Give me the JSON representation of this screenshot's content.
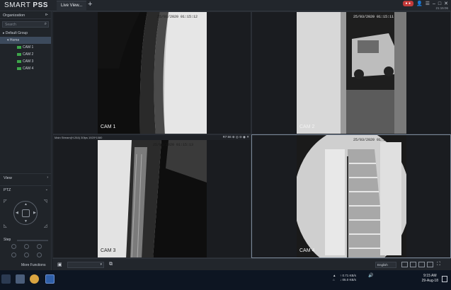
{
  "app": {
    "brand_a": "SMART ",
    "brand_b": "PSS",
    "tab_label": "Live View...",
    "tab_close": "×",
    "tab_add": "+",
    "alarm_badge": "● ●",
    "time_small": "21:15:06"
  },
  "sidebar": {
    "section_title": "Organization",
    "search_placeholder": "Search",
    "tree": [
      {
        "label": "Default Group",
        "level": 1,
        "selected": false
      },
      {
        "label": "Home",
        "level": 2,
        "selected": true
      },
      {
        "label": "CAM 1",
        "level": 3,
        "selected": false
      },
      {
        "label": "CAM 2",
        "level": 3,
        "selected": false
      },
      {
        "label": "CAM 3",
        "level": 3,
        "selected": false
      },
      {
        "label": "CAM 4",
        "level": 3,
        "selected": false
      }
    ],
    "view_label": "View",
    "ptz_label": "PTZ",
    "step_label": "Step",
    "more_label": "More Functions"
  },
  "grid": {
    "cells": [
      {
        "id": "cell-1",
        "cam": "CAM 1",
        "timestamp": "25/03/2020 01:15:12",
        "info": "",
        "active": false
      },
      {
        "id": "cell-2",
        "cam": "CAM 2",
        "timestamp": "25/03/2020 01:15:11",
        "info": "",
        "active": false
      },
      {
        "id": "cell-3",
        "cam": "CAM 3",
        "timestamp": "25/03/2020 01:15:13",
        "info": "Main Stream(H.264) 30fps 1920*1080",
        "active": false
      },
      {
        "id": "cell-4",
        "cam": "CAM 4",
        "timestamp": "25/03/2020 01:15:13",
        "info": "",
        "active": true
      }
    ],
    "tools_text": "R7:66 ⊕ ◎ ⊖ ◉ ✕"
  },
  "bottombar": {
    "stream_value": "English"
  },
  "taskbar": {
    "tray_line1": "↑ 0.71 KB/s",
    "tray_line2": "↓ 05.0 KB/s",
    "time": "9:15 AM",
    "date": "29-Aug-18"
  },
  "colors": {
    "accent": "#3c4a5c",
    "cam_green": "#3ea64a",
    "alarm_red": "#c23a3a"
  }
}
